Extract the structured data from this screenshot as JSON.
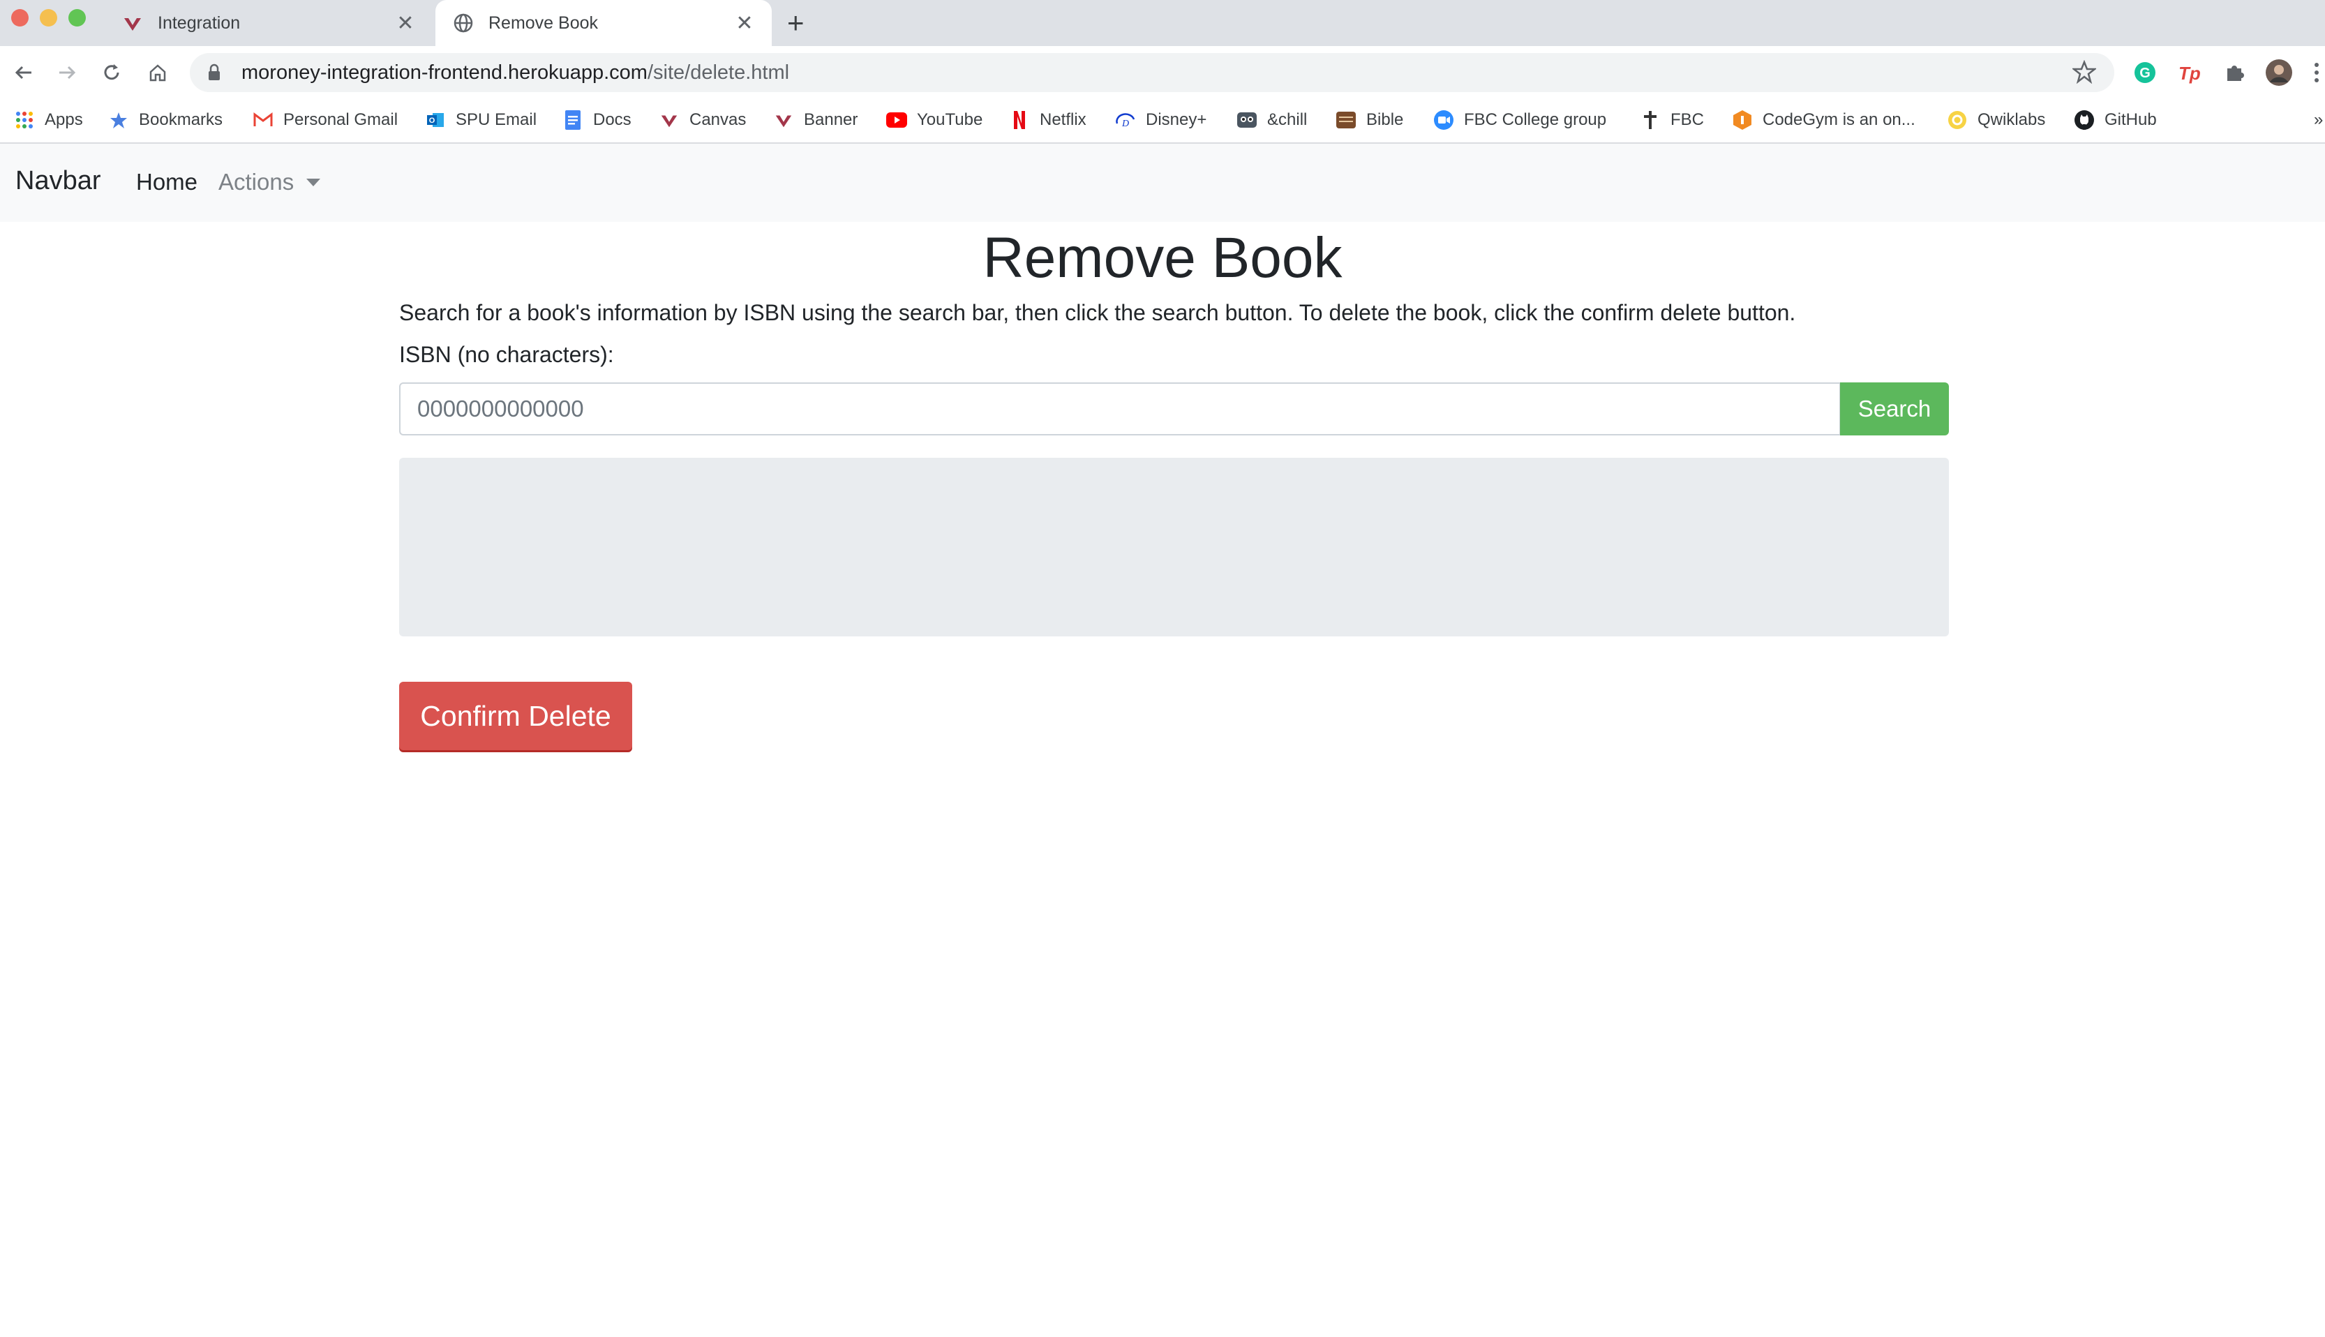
{
  "browser": {
    "tabs": [
      {
        "title": "Integration",
        "active": false
      },
      {
        "title": "Remove Book",
        "active": true
      }
    ],
    "url_host": "moroney-integration-frontend.herokuapp.com",
    "url_path": "/site/delete.html",
    "bookmarks": [
      {
        "label": "Apps",
        "icon": "apps-grid-icon"
      },
      {
        "label": "Bookmarks",
        "icon": "star-icon"
      },
      {
        "label": "Personal Gmail",
        "icon": "gmail-icon"
      },
      {
        "label": "SPU Email",
        "icon": "outlook-icon"
      },
      {
        "label": "Docs",
        "icon": "docs-icon"
      },
      {
        "label": "Canvas",
        "icon": "canvas-icon"
      },
      {
        "label": "Banner",
        "icon": "banner-icon"
      },
      {
        "label": "YouTube",
        "icon": "youtube-icon"
      },
      {
        "label": "Netflix",
        "icon": "netflix-icon"
      },
      {
        "label": "Disney+",
        "icon": "disney-icon"
      },
      {
        "label": "&chill",
        "icon": "raccoon-icon"
      },
      {
        "label": "Bible",
        "icon": "bible-icon"
      },
      {
        "label": "FBC College group",
        "icon": "zoom-icon"
      },
      {
        "label": "FBC",
        "icon": "fbc-icon"
      },
      {
        "label": "CodeGym is an on...",
        "icon": "codegym-icon"
      },
      {
        "label": "Qwiklabs",
        "icon": "qwiklabs-icon"
      },
      {
        "label": "GitHub",
        "icon": "github-icon"
      }
    ],
    "overflow_label": "»"
  },
  "navbar": {
    "brand": "Navbar",
    "home": "Home",
    "actions": "Actions"
  },
  "page": {
    "title": "Remove Book",
    "instructions": "Search for a book's information by ISBN using the search bar, then click the search button. To delete the book, click the confirm delete button.",
    "isbn_label": "ISBN (no characters):",
    "isbn_placeholder": "0000000000000",
    "search_label": "Search",
    "delete_label": "Confirm Delete"
  },
  "colors": {
    "search_button": "#5cb85c",
    "delete_button": "#d9534f",
    "result_box": "#e9ecef",
    "navbar_bg": "#f8f9fa"
  }
}
